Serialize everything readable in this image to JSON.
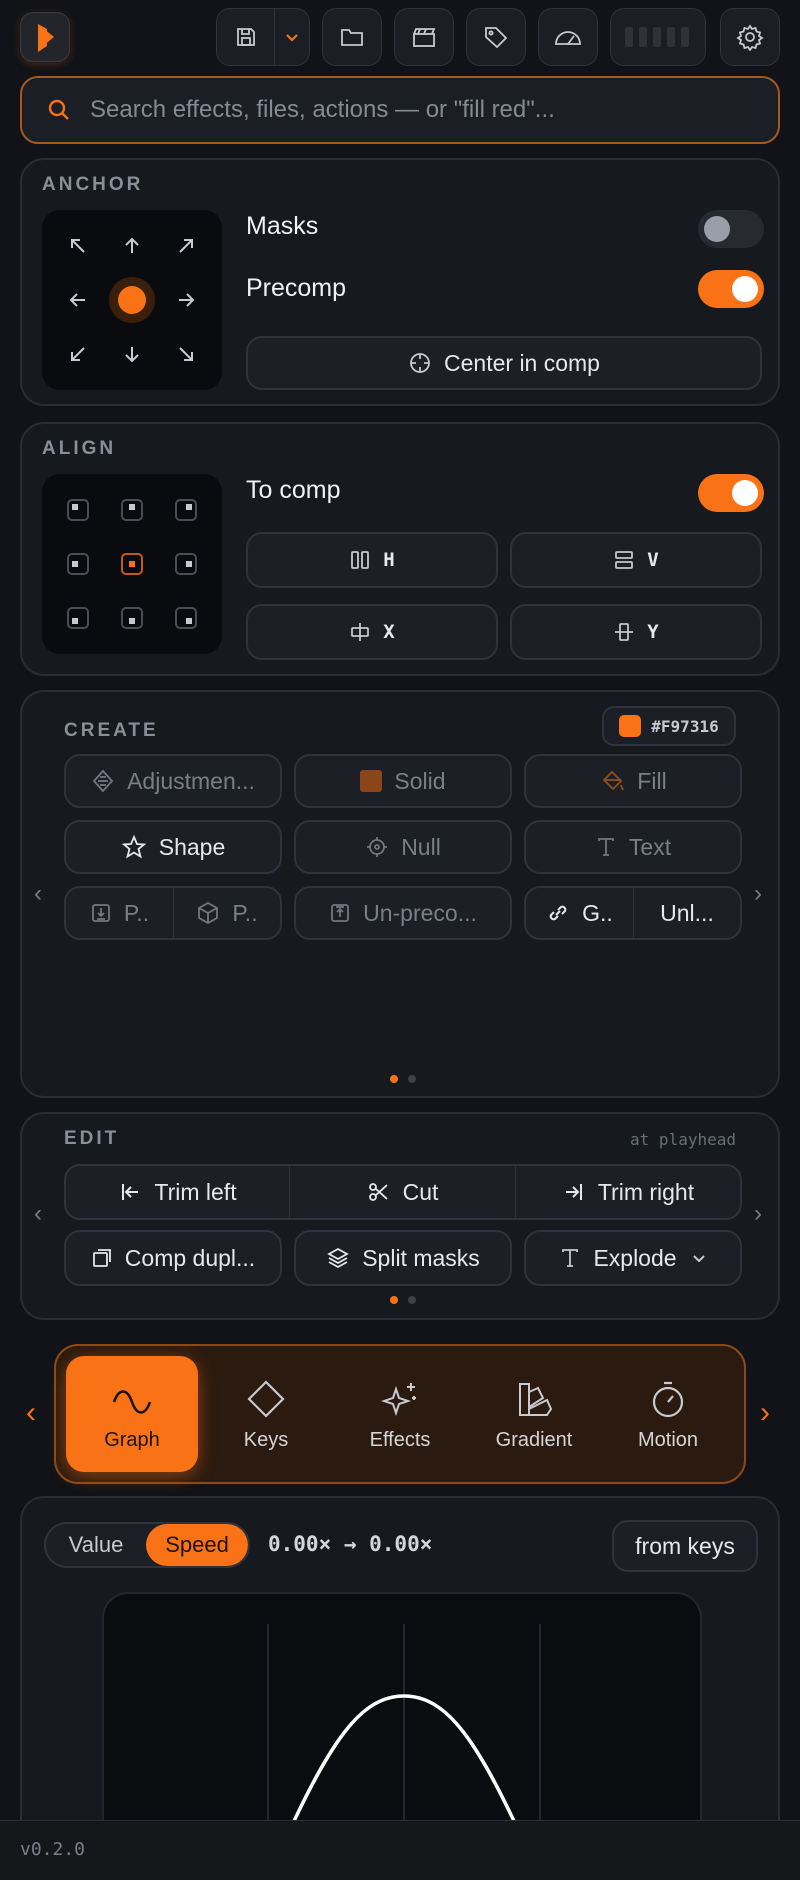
{
  "search": {
    "placeholder": "Search effects, files, actions — or \"fill red\"..."
  },
  "anchor": {
    "title": "ANCHOR",
    "masks_label": "Masks",
    "masks_on": false,
    "precomp_label": "Precomp",
    "precomp_on": true,
    "center_label": "Center in comp"
  },
  "align": {
    "title": "ALIGN",
    "to_comp_label": "To comp",
    "to_comp_on": true,
    "h_label": "H",
    "v_label": "V",
    "x_label": "X",
    "y_label": "Y"
  },
  "create": {
    "title": "CREATE",
    "color_hex": "#F97316",
    "adjustment_label": "Adjustmen...",
    "solid_label": "Solid",
    "fill_label": "Fill",
    "shape_label": "Shape",
    "null_label": "Null",
    "text_label": "Text",
    "p1_label": "P..",
    "p2_label": "P..",
    "unprecomp_label": "Un-preco...",
    "g_label": "G..",
    "unl_label": "Unl..."
  },
  "edit": {
    "title": "EDIT",
    "hint": "at playhead",
    "trim_left": "Trim left",
    "cut": "Cut",
    "trim_right": "Trim right",
    "comp_dupl": "Comp dupl...",
    "split_masks": "Split masks",
    "explode": "Explode"
  },
  "tabs": [
    {
      "label": "Graph",
      "icon": "sine-wave-icon",
      "active": true
    },
    {
      "label": "Keys",
      "icon": "diamond-icon",
      "active": false
    },
    {
      "label": "Effects",
      "icon": "sparkles-icon",
      "active": false
    },
    {
      "label": "Gradient",
      "icon": "swatch-icon",
      "active": false
    },
    {
      "label": "Motion",
      "icon": "stopwatch-icon",
      "active": false
    }
  ],
  "graph": {
    "value_label": "Value",
    "speed_label": "Speed",
    "mode": "Speed",
    "readout": "0.00× → 0.00×",
    "from_keys_label": "from keys"
  },
  "footer": {
    "version": "v0.2.0"
  },
  "colors": {
    "accent": "#F97316",
    "bg": "#111318",
    "panel": "#16191E"
  }
}
